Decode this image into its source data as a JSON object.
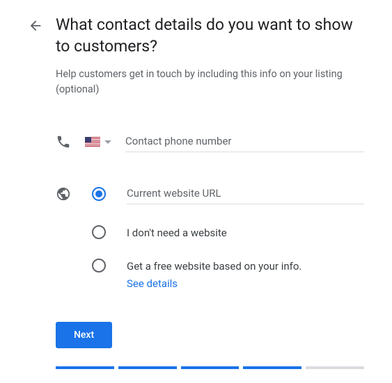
{
  "header": {
    "title": "What contact details do you want to show to customers?",
    "subtitle": "Help customers get in touch by including this info on your listing (optional)"
  },
  "phone": {
    "placeholder": "Contact phone number",
    "country": "US"
  },
  "website": {
    "options": [
      {
        "placeholder": "Current website URL",
        "selected": true
      },
      {
        "label": "I don't need a website"
      },
      {
        "label": "Get a free website based on your info.",
        "link": "See details"
      }
    ]
  },
  "actions": {
    "next": "Next"
  }
}
